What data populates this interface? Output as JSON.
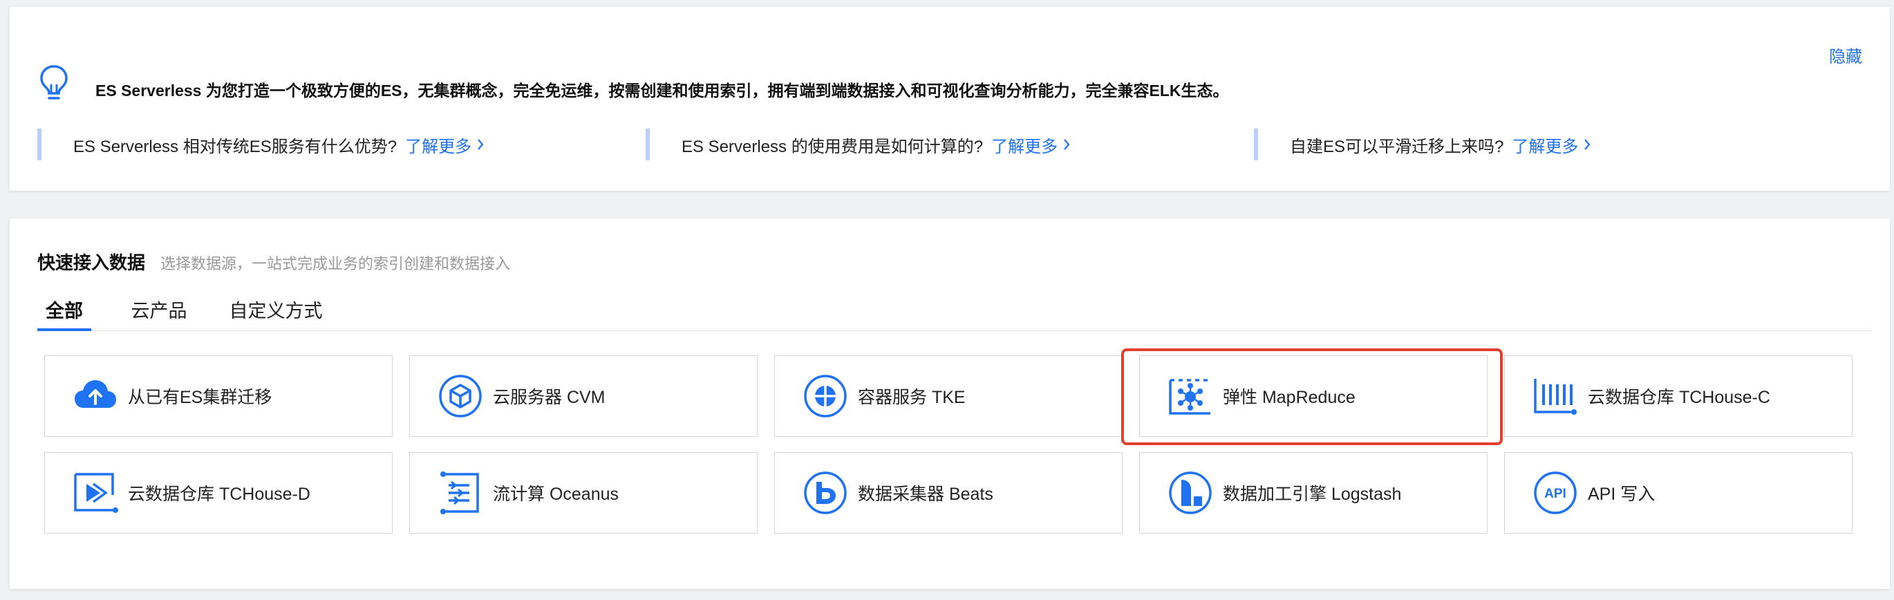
{
  "intro": {
    "text": "ES Serverless 为您打造一个极致方便的ES，无集群概念，完全免运维，按需创建和使用索引，拥有端到端数据接入和可视化查询分析能力，完全兼容ELK生态。",
    "hide_label": "隐藏",
    "faqs": [
      {
        "question": "ES Serverless 相对传统ES服务有什么优势?",
        "link": "了解更多"
      },
      {
        "question": "ES Serverless 的使用费用是如何计算的?",
        "link": "了解更多"
      },
      {
        "question": "自建ES可以平滑迁移上来吗?",
        "link": "了解更多"
      }
    ]
  },
  "quick_access": {
    "title": "快速接入数据",
    "description": "选择数据源，一站式完成业务的索引创建和数据接入",
    "tabs": [
      {
        "label": "全部",
        "active": true
      },
      {
        "label": "云产品",
        "active": false
      },
      {
        "label": "自定义方式",
        "active": false
      }
    ],
    "sources": [
      {
        "label": "从已有ES集群迁移",
        "icon": "cloud-upload-icon"
      },
      {
        "label": "云服务器 CVM",
        "icon": "cvm-cube-icon"
      },
      {
        "label": "容器服务 TKE",
        "icon": "tke-container-icon"
      },
      {
        "label": "弹性 MapReduce",
        "icon": "emr-network-icon"
      },
      {
        "label": "云数据仓库 TCHouse-C",
        "icon": "tchouse-c-icon"
      },
      {
        "label": "云数据仓库 TCHouse-D",
        "icon": "tchouse-d-icon"
      },
      {
        "label": "流计算 Oceanus",
        "icon": "oceanus-stream-icon"
      },
      {
        "label": "数据采集器 Beats",
        "icon": "beats-icon"
      },
      {
        "label": "数据加工引擎 Logstash",
        "icon": "logstash-icon"
      },
      {
        "label": "API 写入",
        "icon": "api-icon"
      }
    ],
    "highlighted_source": "弹性 MapReduce"
  },
  "colors": {
    "accent": "#1f72f2",
    "highlight_border": "#e3412f",
    "faq_bar": "#b9d1f7",
    "page_bg": "#f0f1f3"
  }
}
